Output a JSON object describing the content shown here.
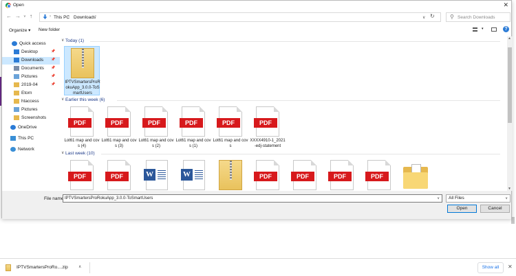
{
  "window": {
    "title": "Open",
    "close": "✕"
  },
  "address": {
    "crumbs": [
      "This PC",
      "Downloads"
    ],
    "search_placeholder": "Search Downloads"
  },
  "toolbar": {
    "organize": "Organize ▾",
    "new_folder": "New folder",
    "help": "?"
  },
  "nav": {
    "items": [
      {
        "label": "Quick access",
        "icon": "star-icon",
        "pinned": false,
        "selected": false
      },
      {
        "label": "Desktop",
        "icon": "desktop-icon",
        "pinned": true,
        "selected": false
      },
      {
        "label": "Downloads",
        "icon": "download-icon",
        "pinned": true,
        "selected": true
      },
      {
        "label": "Documents",
        "icon": "documents-icon",
        "pinned": true,
        "selected": false
      },
      {
        "label": "Pictures",
        "icon": "pictures-icon",
        "pinned": true,
        "selected": false
      },
      {
        "label": "2019-04",
        "icon": "folder-icon",
        "pinned": true,
        "selected": false
      },
      {
        "label": "Etorn",
        "icon": "folder-icon",
        "pinned": false,
        "selected": false
      },
      {
        "label": "htaccess",
        "icon": "folder-icon",
        "pinned": false,
        "selected": false
      },
      {
        "label": "Pictures",
        "icon": "pictures-icon",
        "pinned": false,
        "selected": false
      },
      {
        "label": "Screenshots",
        "icon": "folder-icon",
        "pinned": false,
        "selected": false
      },
      {
        "label": "OneDrive",
        "icon": "cloud-icon",
        "pinned": false,
        "selected": false
      },
      {
        "label": "This PC",
        "icon": "pc-icon",
        "pinned": false,
        "selected": false
      },
      {
        "label": "Network",
        "icon": "network-icon",
        "pinned": false,
        "selected": false
      }
    ]
  },
  "groups": [
    {
      "label": "Today (1)",
      "files": [
        {
          "type": "zip",
          "name": "IPTVSmartersProRokuApp_3.0.0-ToSmartUsers",
          "selected": true
        }
      ]
    },
    {
      "label": "Earlier this week (6)",
      "files": [
        {
          "type": "pdf",
          "name": "Lot61 map and covs (4)"
        },
        {
          "type": "pdf",
          "name": "Lot61 map and covs (3)"
        },
        {
          "type": "pdf",
          "name": "Lot61 map and covs (2)"
        },
        {
          "type": "pdf",
          "name": "Lot61 map and covs (1)"
        },
        {
          "type": "pdf",
          "name": "Lot61 map and covs"
        },
        {
          "type": "pdf",
          "name": "XXXX4910-1_2021-edj-statement"
        }
      ]
    },
    {
      "label": "Last week (10)",
      "files": [
        {
          "type": "pdf",
          "name": ""
        },
        {
          "type": "pdf",
          "name": ""
        },
        {
          "type": "word",
          "name": ""
        },
        {
          "type": "word",
          "name": ""
        },
        {
          "type": "zip",
          "name": ""
        },
        {
          "type": "pdf",
          "name": ""
        },
        {
          "type": "pdf",
          "name": ""
        },
        {
          "type": "pdf",
          "name": ""
        },
        {
          "type": "pdf",
          "name": ""
        },
        {
          "type": "folder",
          "name": ""
        }
      ]
    }
  ],
  "footer": {
    "filename_label": "File name:",
    "filename_value": "IPTVSmartersProRokuApp_3.0.0-ToSmartUsers",
    "filetype": "All Files",
    "open": "Open",
    "cancel": "Cancel"
  },
  "downloads": {
    "item": "IPTVSmartersProRo....zip",
    "show_all": "Show all"
  },
  "icons": {
    "pdf_label": "PDF",
    "word_label": "W"
  },
  "colors": {
    "accent": "#0078d7",
    "selection": "#cce8ff",
    "pdf_red": "#d7191c",
    "word_blue": "#2b579a"
  }
}
